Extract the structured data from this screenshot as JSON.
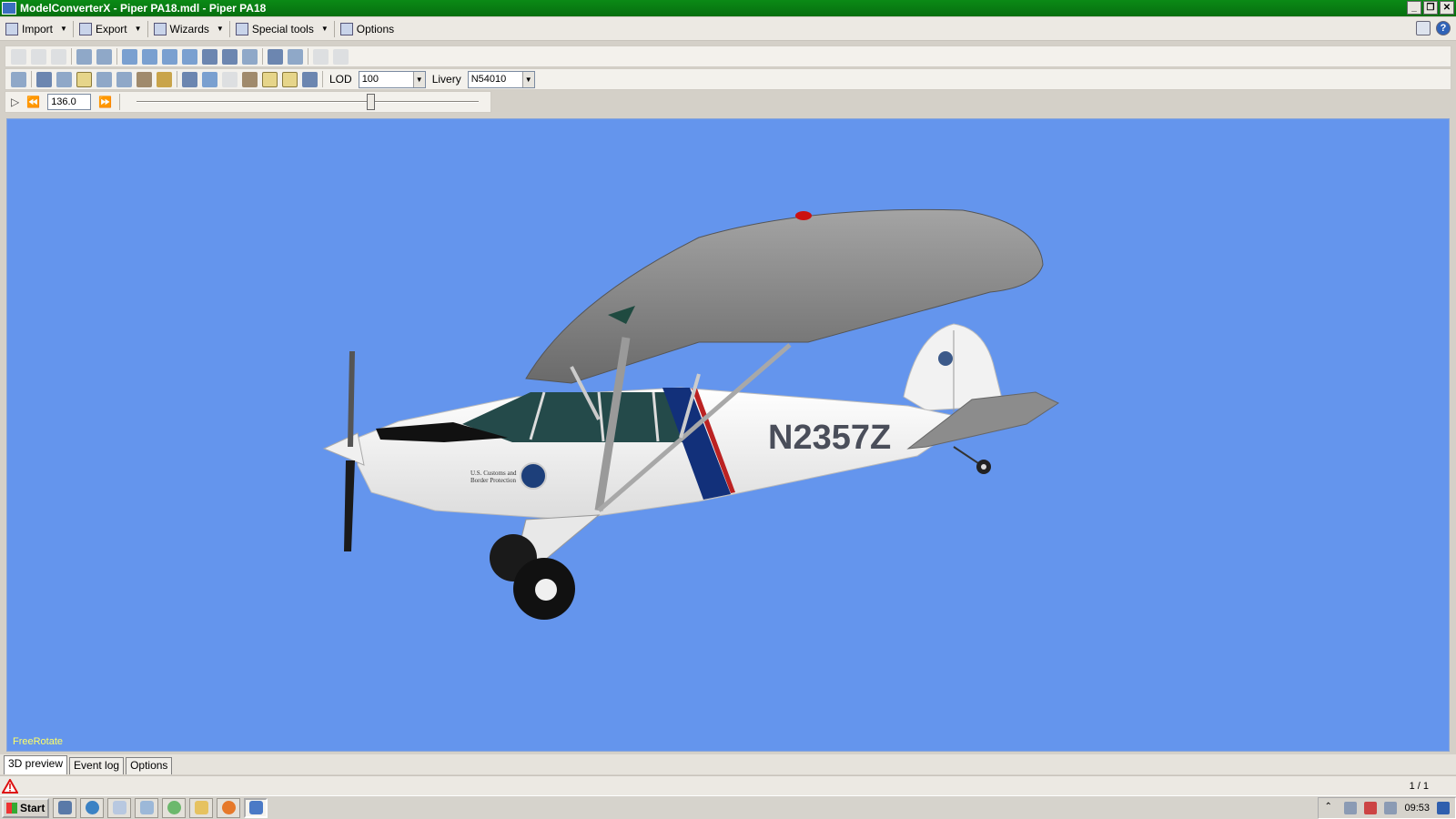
{
  "window": {
    "title": "ModelConverterX - Piper PA18.mdl - Piper PA18",
    "controls": [
      "_",
      "❐",
      "✕"
    ]
  },
  "menu": {
    "items": [
      {
        "label": "Import",
        "icon": "import-icon",
        "dropdown": true
      },
      {
        "label": "Export",
        "icon": "export-icon",
        "dropdown": true
      },
      {
        "label": "Wizards",
        "icon": "wizard-wand-icon",
        "dropdown": true
      },
      {
        "label": "Special tools",
        "icon": "gear-icon",
        "dropdown": true
      },
      {
        "label": "Options",
        "icon": "tools-icon",
        "dropdown": false
      }
    ],
    "help_glyph": "?"
  },
  "display_toolbar": {
    "lod_label": "LOD",
    "lod_value": "100",
    "livery_label": "Livery",
    "livery_value": "N54010"
  },
  "animation": {
    "time_value": "136.0",
    "slider_position": 0.69
  },
  "viewport": {
    "background_color": "#6495ED",
    "mode_label": "FreeRotate",
    "aircraft_registration": "N2357Z",
    "fuselage_text_line1": "U.S. Customs and",
    "fuselage_text_line2": "Border Protection"
  },
  "tabs": [
    {
      "label": "3D preview",
      "active": true
    },
    {
      "label": "Event log",
      "active": false
    },
    {
      "label": "Options",
      "active": false
    }
  ],
  "status": {
    "pager": "1 / 1",
    "warning_icon": "warning-triangle-icon"
  },
  "taskbar": {
    "start_label": "Start",
    "clock": "09:53"
  }
}
